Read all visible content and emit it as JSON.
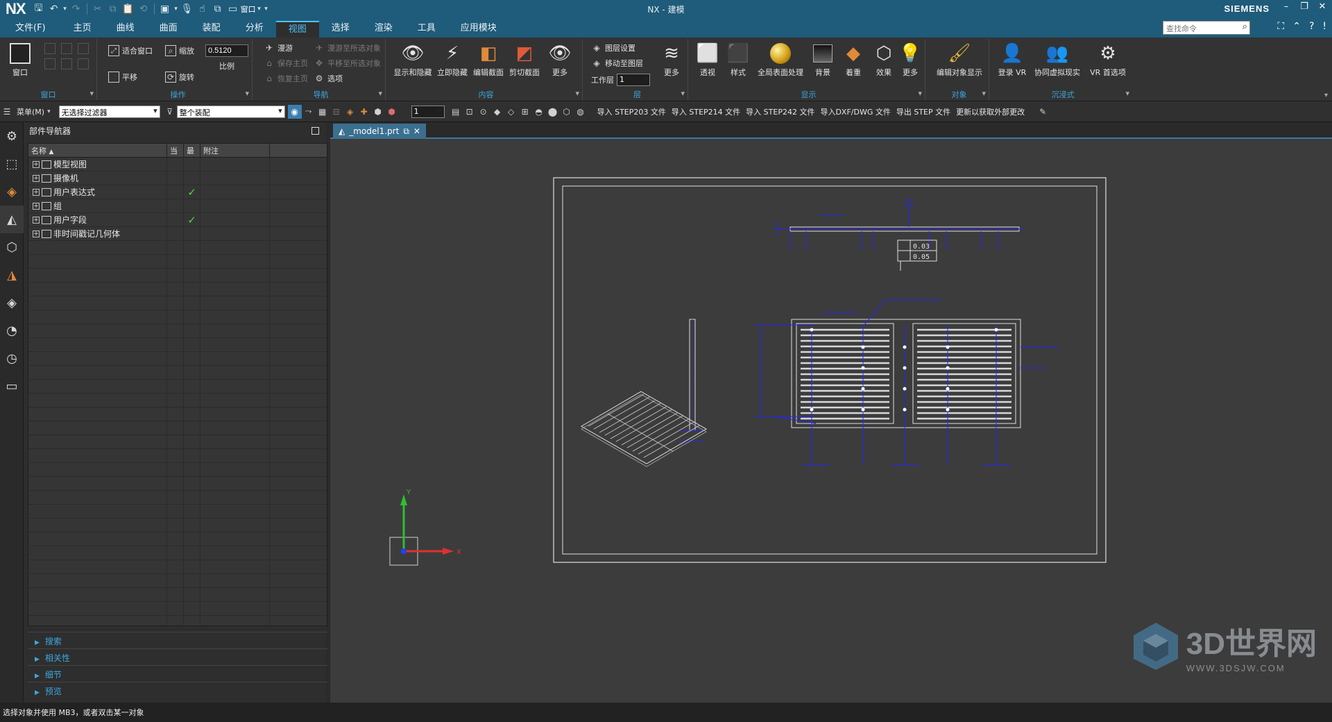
{
  "app": {
    "logo": "NX",
    "window_title": "NX - 建模",
    "brand": "SIEMENS",
    "window_controls": [
      "–",
      "❐",
      "✕"
    ]
  },
  "quick_access": {
    "window_label": "窗口"
  },
  "menu": {
    "tabs": [
      "文件(F)",
      "主页",
      "曲线",
      "曲面",
      "装配",
      "分析",
      "视图",
      "选择",
      "渲染",
      "工具",
      "应用模块"
    ],
    "active_index": 6,
    "search_placeholder": "查找命令"
  },
  "ribbon": {
    "window_group": {
      "label": "窗口",
      "btn": "窗口"
    },
    "operate_group": {
      "label": "操作",
      "fit": "适合窗口",
      "zoom": "缩放",
      "zoom_value": "0.5120",
      "scale": "比例",
      "pan": "平移",
      "rotate": "旋转"
    },
    "nav_group": {
      "label": "导航",
      "walk": "漫游",
      "walk_to": "漫游至所选对象",
      "save_home": "保存主页",
      "pan_to": "平移至所选对象",
      "restore_home": "恢复主页",
      "options": "选项"
    },
    "content_group": {
      "label": "内容",
      "buttons": [
        "显示和隐藏",
        "立即隐藏",
        "编辑截面",
        "剪切截面",
        "更多"
      ]
    },
    "layer_group": {
      "label": "层",
      "layer_settings": "图层设置",
      "move_to_layer": "移动至图层",
      "work_layer": "工作层",
      "work_layer_value": "1",
      "more": "更多"
    },
    "display_group": {
      "label": "显示",
      "buttons": [
        "透视",
        "样式",
        "全局表面处理",
        "背景",
        "着重",
        "效果",
        "更多"
      ]
    },
    "object_group": {
      "label": "对象",
      "btn": "编辑对象显示"
    },
    "vr_group": {
      "label": "沉浸式",
      "buttons": [
        "登录 VR",
        "协同虚拟现实",
        "VR 首选项"
      ]
    }
  },
  "toolbar2": {
    "menu_label": "菜单(M)",
    "filter": "无选择过滤器",
    "scope": "整个装配",
    "layer_combo": "1",
    "actions": [
      "导入 STEP203 文件",
      "导入 STEP214 文件",
      "导入 STEP242 文件",
      "导入DXF/DWG 文件",
      "导出 STEP 文件",
      "更新以获取外部更改"
    ]
  },
  "navigator": {
    "title": "部件导航器",
    "columns": [
      "名称",
      "当",
      "最",
      "附注"
    ],
    "rows": [
      {
        "label": "模型视图",
        "check": false
      },
      {
        "label": "摄像机",
        "check": false
      },
      {
        "label": "用户表达式",
        "check": true
      },
      {
        "label": "组",
        "check": false
      },
      {
        "label": "用户字段",
        "check": true
      },
      {
        "label": "非时间戳记几何体",
        "check": false
      }
    ],
    "accordions": [
      "搜索",
      "相关性",
      "细节",
      "预览"
    ]
  },
  "viewport": {
    "tab_label": "_model1.prt",
    "tolerance_1": "0.03",
    "tolerance_2": "0.05",
    "axis_x": "X",
    "axis_y": "Y"
  },
  "status": {
    "message": "选择对象并使用 MB3，或者双击某一对象"
  },
  "watermark": {
    "title": "3D世界网",
    "url": "WWW.3DSJW.COM"
  },
  "colors": {
    "titlebar": "#1f5b7a",
    "accent": "#3aa8e0",
    "drawing_blue": "#2020ff",
    "check_green": "#4cdc3c"
  }
}
